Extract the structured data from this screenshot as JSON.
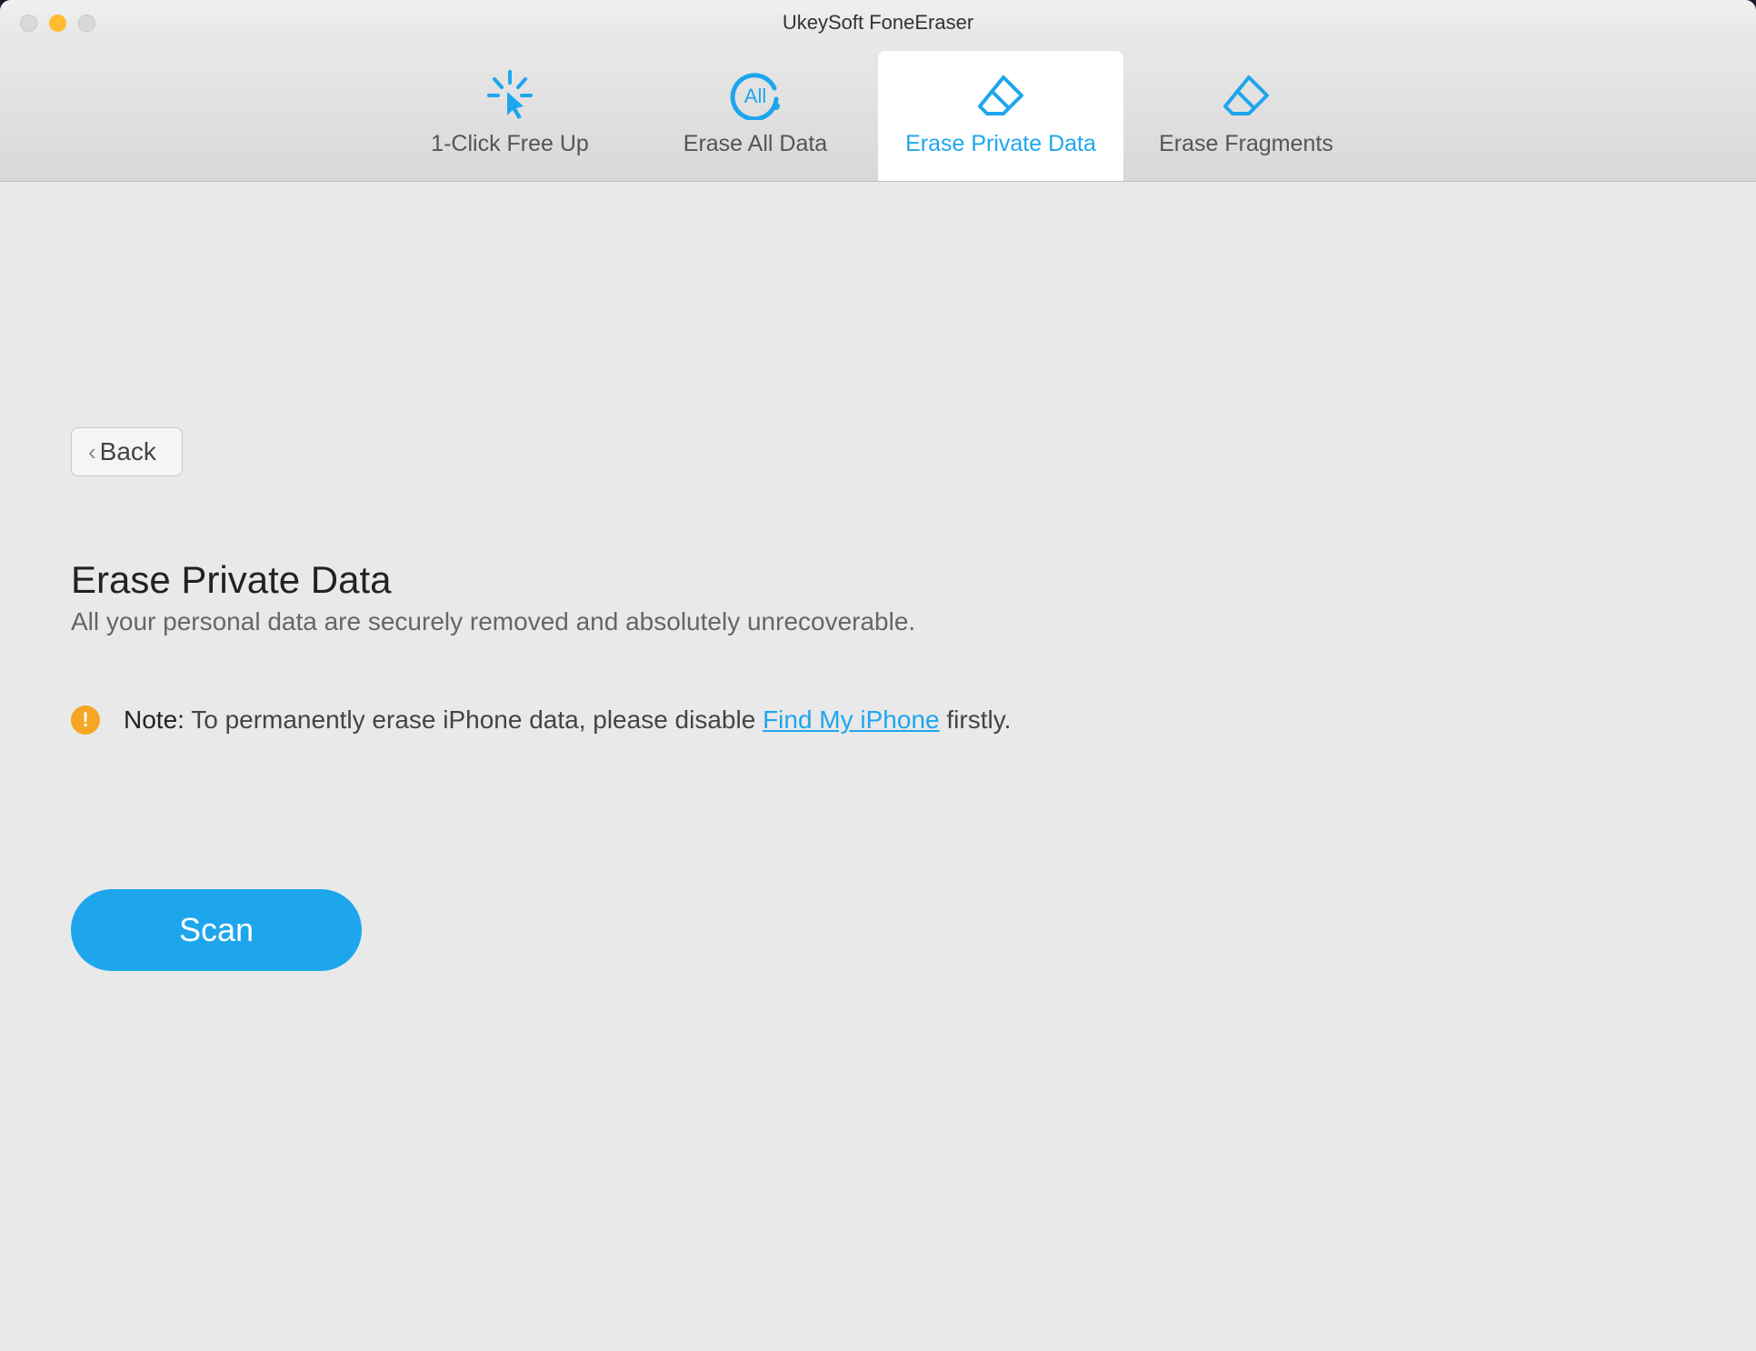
{
  "window": {
    "title": "UkeySoft FoneEraser"
  },
  "tabs": [
    {
      "label": "1-Click Free Up",
      "active": false
    },
    {
      "label": "Erase All Data",
      "active": false
    },
    {
      "label": "Erase Private Data",
      "active": true
    },
    {
      "label": "Erase Fragments",
      "active": false
    }
  ],
  "back_label": "Back",
  "page": {
    "heading": "Erase Private Data",
    "subtitle": "All your personal data are securely removed and absolutely unrecoverable."
  },
  "note": {
    "label": "Note:",
    "text_before": " To permanently erase iPhone data, please disable ",
    "link_text": "Find My iPhone",
    "text_after": " firstly."
  },
  "scan_label": "Scan"
}
